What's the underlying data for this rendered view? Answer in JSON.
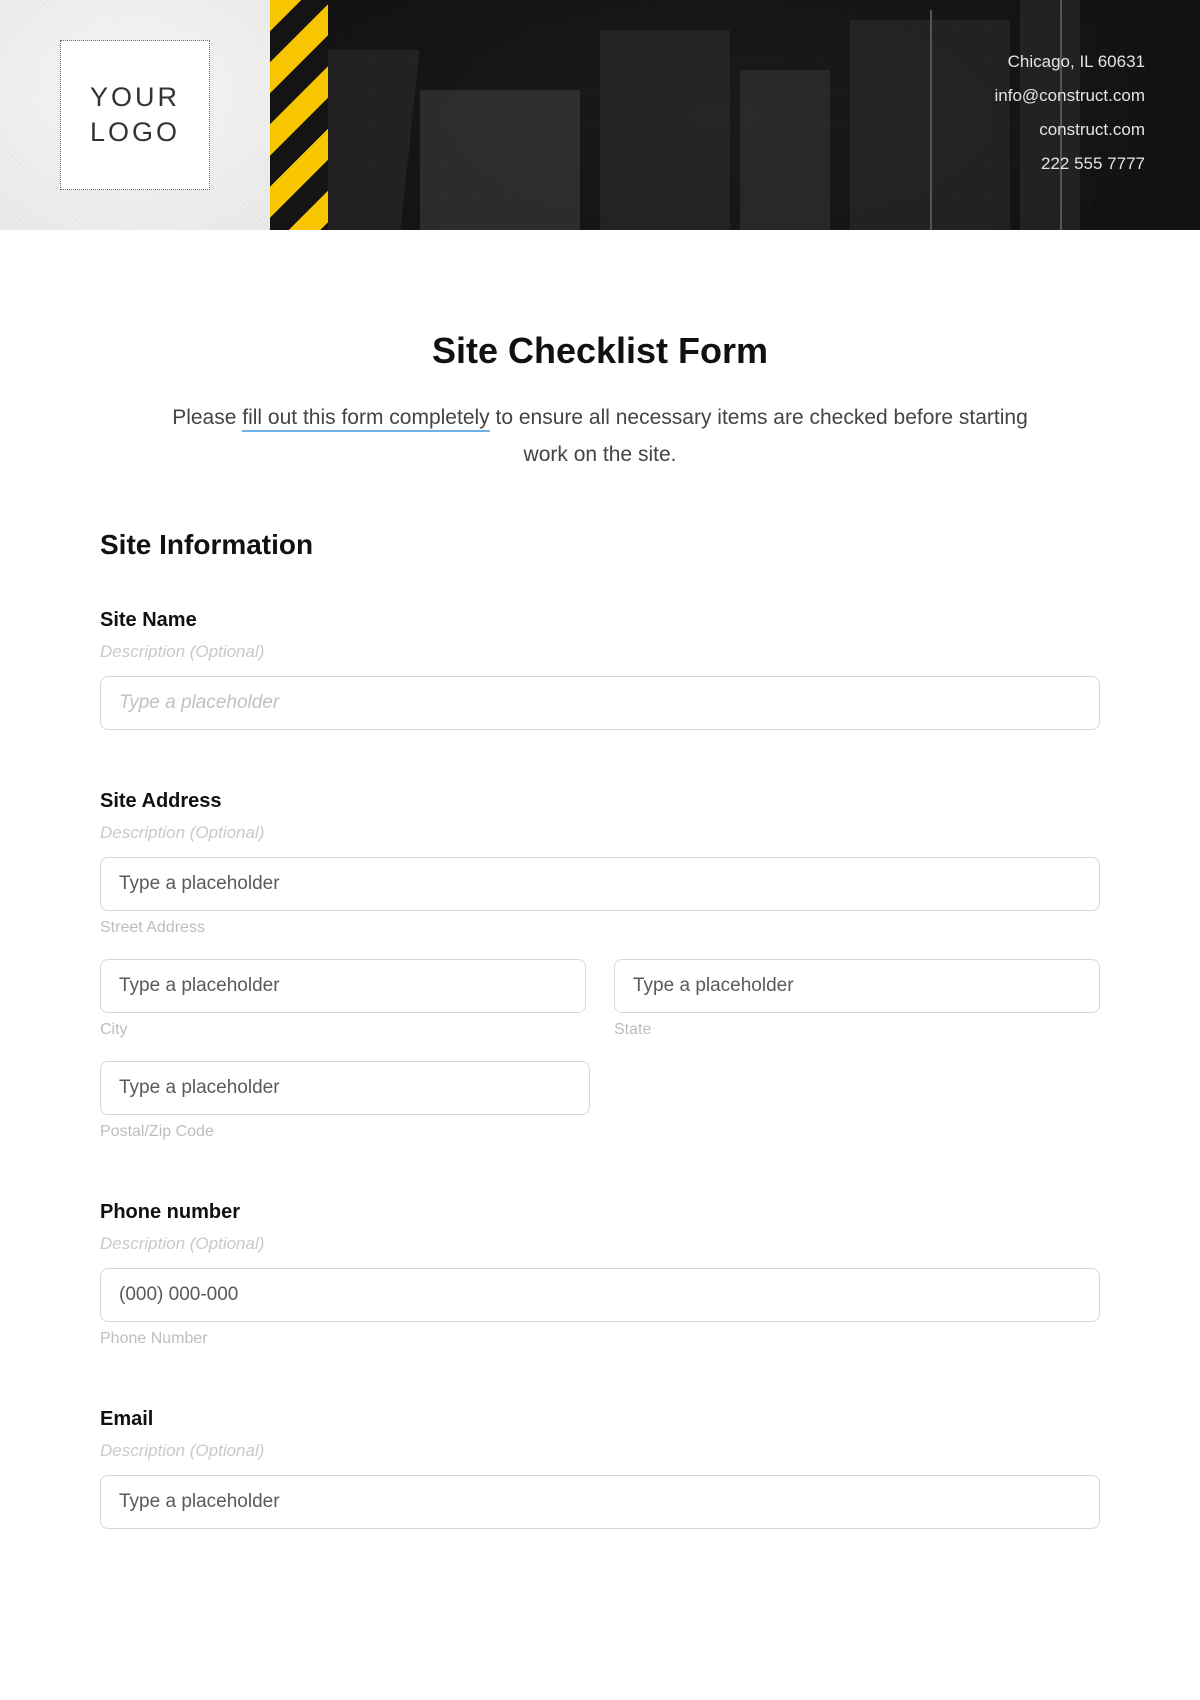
{
  "header": {
    "logo_line1": "YOUR",
    "logo_line2": "LOGO",
    "contact_lines": [
      "Chicago, IL 60631",
      "info@construct.com",
      "construct.com",
      "222 555 7777"
    ]
  },
  "form": {
    "title": "Site Checklist Form",
    "intro_prefix": "Please ",
    "intro_underlined": "fill out this form completely",
    "intro_suffix": " to ensure all necessary items are checked before starting work on the site.",
    "section_heading": "Site Information",
    "desc_optional": "Description (Optional)",
    "site_name": {
      "label": "Site Name",
      "placeholder": "Type a placeholder"
    },
    "site_address": {
      "label": "Site Address",
      "street_placeholder": "Type a placeholder",
      "street_sub": "Street Address",
      "city_placeholder": "Type a placeholder",
      "city_sub": "City",
      "state_placeholder": "Type a placeholder",
      "state_sub": "State",
      "zip_placeholder": "Type a placeholder",
      "zip_sub": "Postal/Zip Code"
    },
    "phone": {
      "label": "Phone number",
      "placeholder": "(000) 000-000",
      "sub": "Phone Number"
    },
    "email": {
      "label": "Email",
      "placeholder": "Type a placeholder"
    }
  }
}
